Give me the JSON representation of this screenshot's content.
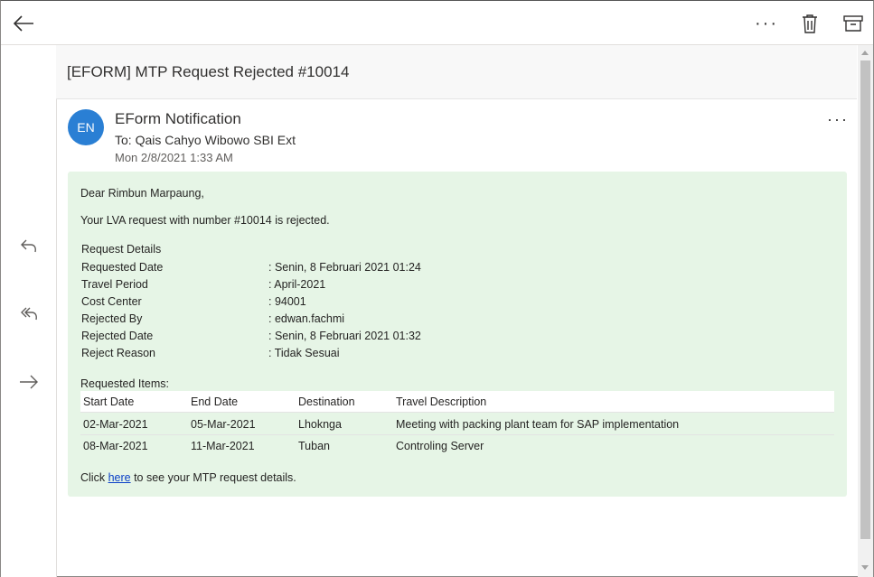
{
  "toolbar": {
    "more_label": "···"
  },
  "subject": "[EFORM] MTP Request Rejected #10014",
  "message": {
    "avatar_initials": "EN",
    "sender": "EForm Notification",
    "to": "To: Qais Cahyo Wibowo SBI Ext",
    "date": "Mon 2/8/2021 1:33 AM",
    "more_label": "···"
  },
  "body": {
    "greeting": "Dear Rimbun Marpaung,",
    "intro": "Your LVA request with number #10014 is rejected.",
    "details_title": "Request Details",
    "details": [
      {
        "label": "Requested Date",
        "value": ": Senin, 8 Februari 2021 01:24"
      },
      {
        "label": "Travel Period",
        "value": ": April-2021"
      },
      {
        "label": "Cost Center",
        "value": ": 94001"
      },
      {
        "label": "Rejected By",
        "value": ": edwan.fachmi"
      },
      {
        "label": "Rejected Date",
        "value": ": Senin, 8 Februari 2021 01:32"
      },
      {
        "label": "Reject Reason",
        "value": ": Tidak Sesuai"
      }
    ],
    "items_title": "Requested Items:",
    "items_headers": [
      "Start Date",
      "End Date",
      "Destination",
      "Travel Description"
    ],
    "items_rows": [
      [
        "02-Mar-2021",
        "05-Mar-2021",
        "Lhoknga",
        "Meeting with packing plant team for SAP implementation"
      ],
      [
        "08-Mar-2021",
        "11-Mar-2021",
        "Tuban",
        "Controling Server"
      ]
    ],
    "footer_prefix": "Click ",
    "footer_link": "here",
    "footer_suffix": " to see your MTP request details."
  },
  "colors": {
    "avatar": "#2a7fd4",
    "body_bg": "#e6f5e6",
    "link": "#0b40c7"
  },
  "icons": [
    "back-arrow-icon",
    "more-icon",
    "trash-icon",
    "archive-icon",
    "reply-icon",
    "reply-all-icon",
    "forward-icon"
  ]
}
